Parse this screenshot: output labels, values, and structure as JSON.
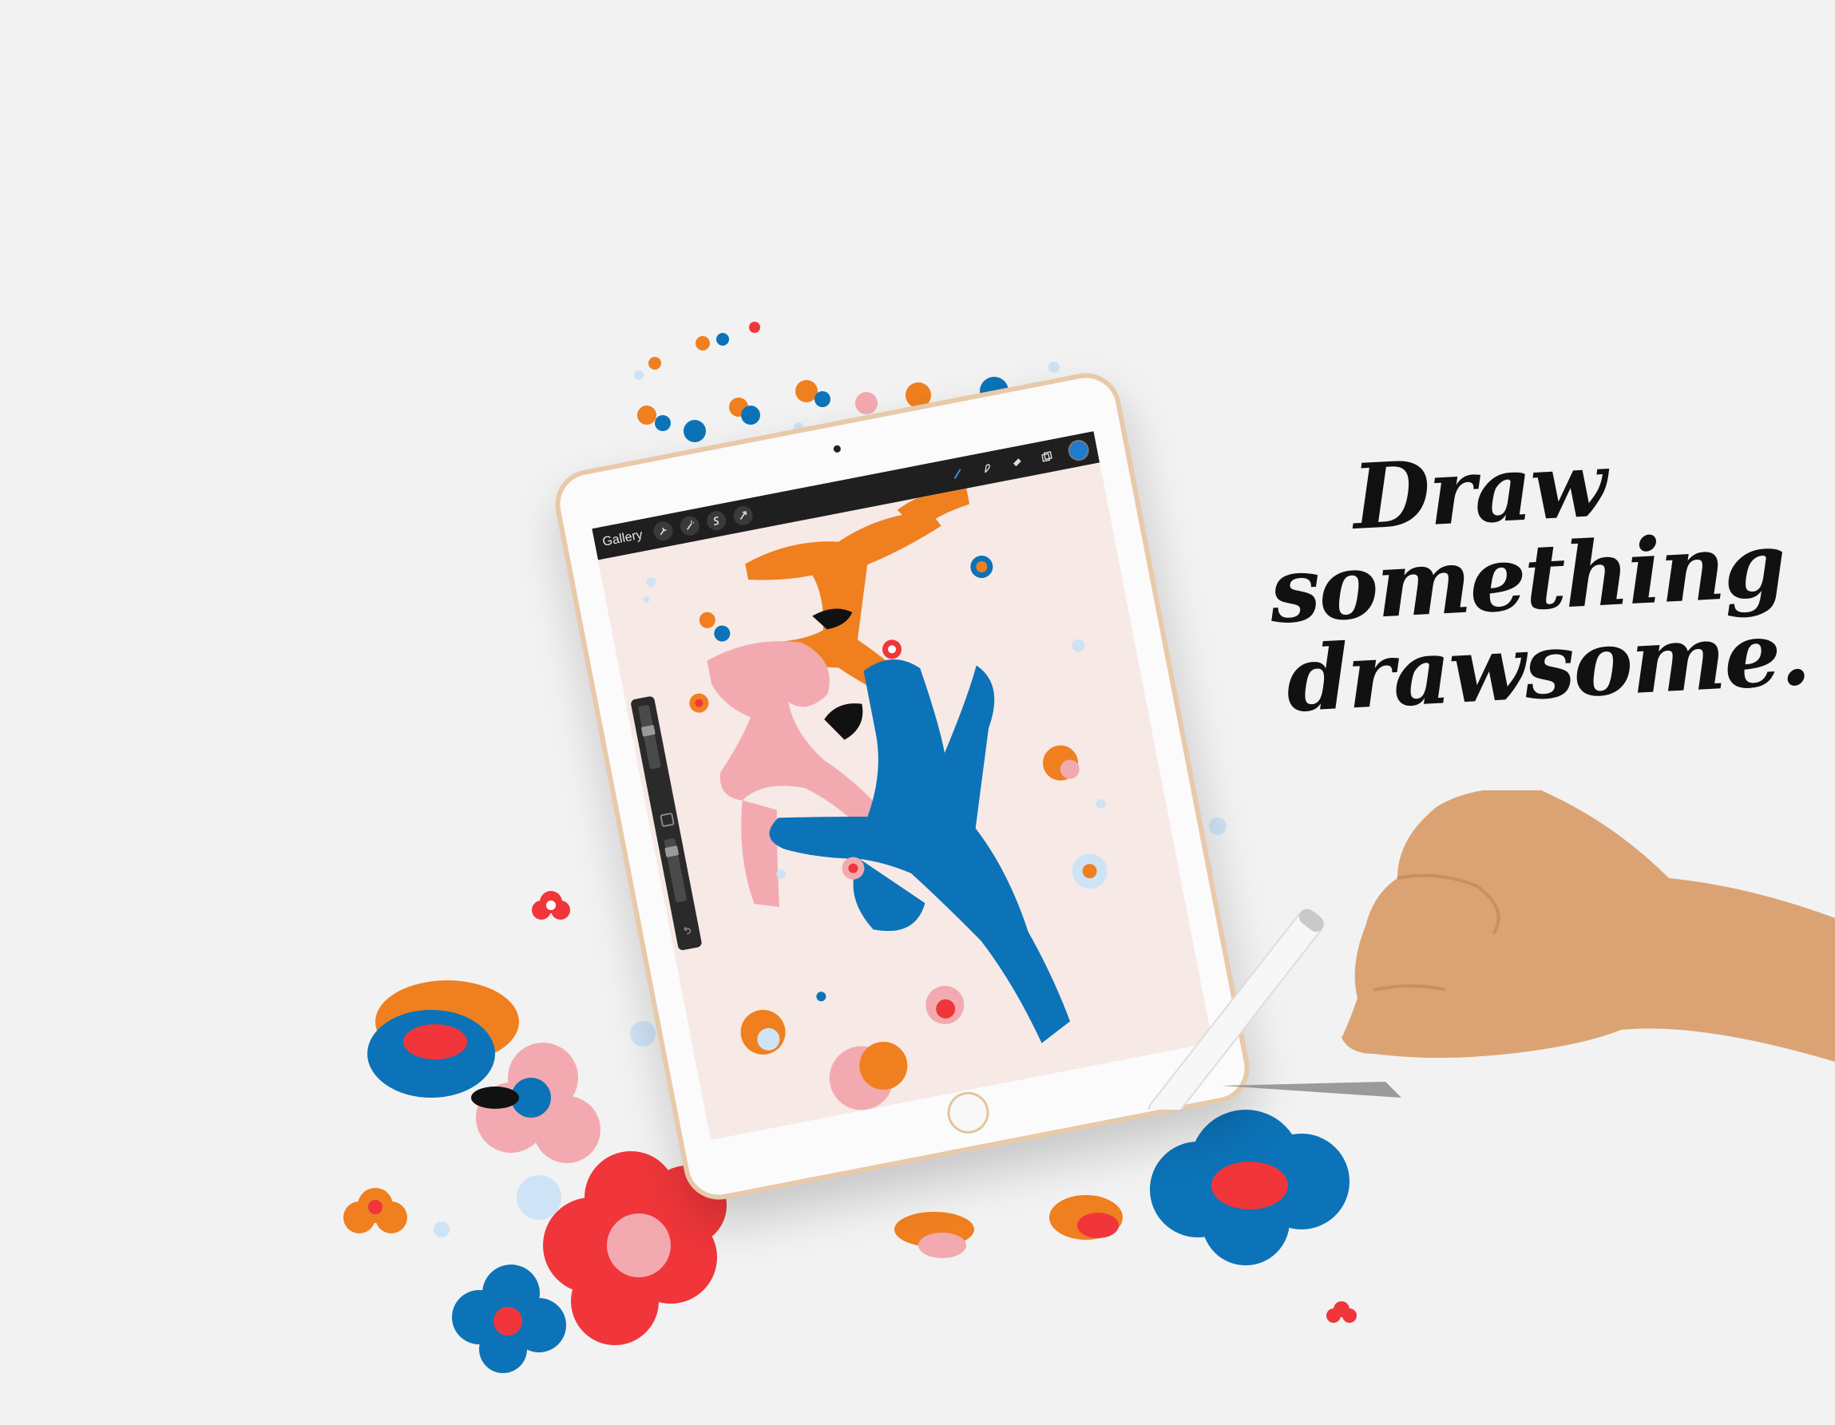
{
  "headline": {
    "line1": "Draw",
    "line2": "something",
    "line3": "drawsome."
  },
  "app": {
    "gallery_label": "Gallery",
    "toolbar_left_icons": [
      "wrench-icon",
      "magic-wand-icon",
      "selection-s-icon",
      "arrow-cursor-icon"
    ],
    "toolbar_right_icons": [
      "brush-icon",
      "smudge-icon",
      "eraser-icon",
      "layers-icon"
    ],
    "active_color": "#1f7bd0"
  },
  "colors": {
    "orange": "#f07f1f",
    "blue": "#0c73b8",
    "pink": "#f2aab0",
    "red": "#f0363a",
    "light_blue": "#cfe3f6",
    "canvas": "#f7e9e6",
    "gold_frame": "#e8c9a8"
  }
}
